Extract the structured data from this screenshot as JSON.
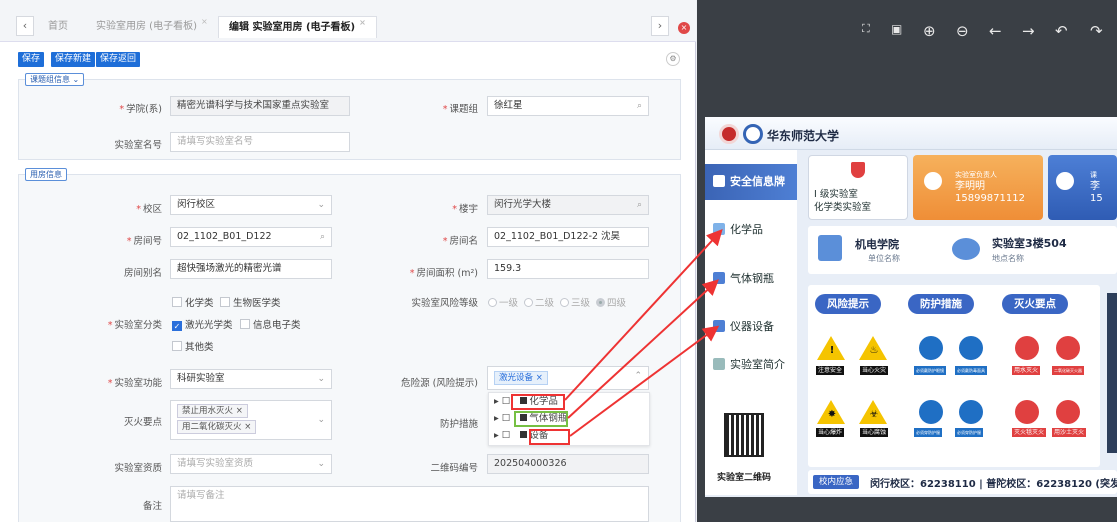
{
  "tabs": {
    "home": "首页",
    "t1": "实验室用房 (电子看板)",
    "t2": "编辑 实验室用房 (电子看板)",
    "close": "×"
  },
  "toolbar": {
    "save": "保存",
    "save_new": "保存新建",
    "save_back": "保存返回"
  },
  "sections": {
    "group": "课题组信息",
    "room": "用房信息"
  },
  "form": {
    "college_label": "学院(系)",
    "college_value": "精密光谱科学与技术国家重点实验室",
    "group_label": "课题组",
    "group_value": "徐红星",
    "lab_name_label": "实验室名号",
    "lab_name_ph": "请填写实验室名号",
    "campus_label": "校区",
    "campus_value": "闵行校区",
    "building_label": "楼宇",
    "building_value": "闵行光学大楼",
    "room_no_label": "房间号",
    "room_no_value": "02_1102_B01_D122",
    "room_name_label": "房间名",
    "room_name_value": "02_1102_B01_D122-2 沈昊",
    "alias_label": "房间别名",
    "alias_value": "超快强场激光的精密光谱",
    "area_label": "房间面积 (m²)",
    "area_value": "159.3",
    "category_label": "实验室分类",
    "cat_options": [
      "化学类",
      "生物医学类",
      "激光光学类",
      "信息电子类",
      "其他类"
    ],
    "risk_label": "实验室风险等级",
    "risk_options": [
      "一级",
      "二级",
      "三级",
      "四级"
    ],
    "function_label": "实验室功能",
    "function_value": "科研实验室",
    "hazard_label": "危险源 (风险提示)",
    "hazard_tag": "激光设备",
    "hazard_options": [
      "化学品",
      "气体钢瓶",
      "设备"
    ],
    "fire_label": "灭火要点",
    "fire_tags": [
      "禁止用水灭火",
      "用二氧化碳灭火"
    ],
    "protect_label": "防护措施",
    "qual_label": "实验室资质",
    "qual_ph": "请填写实验室资质",
    "qr_label": "二维码编号",
    "qr_value": "202504000326",
    "note_label": "备注",
    "note_ph": "请填写备注"
  },
  "board": {
    "university": "华东师范大学",
    "nav": [
      "安全信息牌",
      "化学品",
      "气体钢瓶",
      "仪器设备",
      "实验室简介"
    ],
    "qr_caption": "实验室二维码",
    "level_line1": "I 级实验室",
    "level_line2": "化学类实验室",
    "leader_caption": "实验室负责人",
    "leader_name": "李明明",
    "leader_phone": "15899871112",
    "card3_caption": "课",
    "card3_name": "李",
    "card3_phone": "15",
    "unit_name": "机电学院",
    "unit_caption": "单位名称",
    "room_name": "实验室3楼504",
    "room_caption": "地点名称",
    "hz_tabs": [
      "风险提示",
      "防护措施",
      "灭火要点"
    ],
    "signs_row1": [
      "注意安全",
      "当心火灾",
      "必须戴防护眼镜",
      "必须戴防毒面具",
      "用水灭火",
      "二氧化碳灭火器"
    ],
    "signs_row2": [
      "当心爆炸",
      "当心腐蚀",
      "必须穿防护服",
      "必须穿防护服",
      "灭火毯灭火",
      "用沙土灭火"
    ],
    "footer_tag": "校内应急",
    "footer_text": "闵行校区：62238110 | 普陀校区：62238120 (突发"
  },
  "colors": {
    "primary": "#1e6ed8",
    "board_blue": "#3a66c4",
    "highlight_red": "#e33333",
    "highlight_green": "#76c043"
  }
}
